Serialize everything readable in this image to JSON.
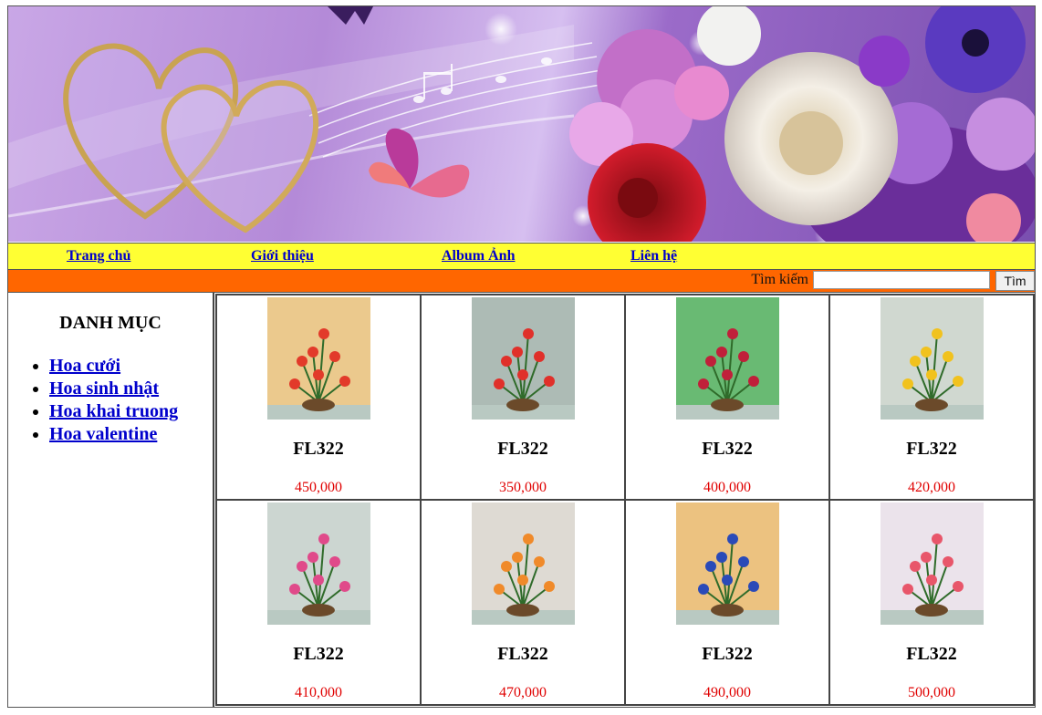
{
  "nav": {
    "items": [
      {
        "label": "Trang chủ"
      },
      {
        "label": "Giới thiệu"
      },
      {
        "label": "Album Ảnh"
      },
      {
        "label": "Liên hệ"
      }
    ]
  },
  "search": {
    "label": "Tìm kiếm",
    "placeholder": "",
    "button_label": "Tìm"
  },
  "sidebar": {
    "title": "DANH MỤC",
    "items": [
      {
        "label": "Hoa cưới"
      },
      {
        "label": "Hoa sinh nhật"
      },
      {
        "label": "Hoa khai truong"
      },
      {
        "label": "Hoa valentine"
      }
    ]
  },
  "products": [
    {
      "code": "FL322",
      "price": "450,000",
      "bg": "#e8c07a",
      "flower": "#e23a2a"
    },
    {
      "code": "FL322",
      "price": "350,000",
      "bg": "#9fb0a9",
      "flower": "#e0302a"
    },
    {
      "code": "FL322",
      "price": "400,000",
      "bg": "#4fae5b",
      "flower": "#c0203a"
    },
    {
      "code": "FL322",
      "price": "420,000",
      "bg": "#c8d2c8",
      "flower": "#f1c21e"
    },
    {
      "code": "FL322",
      "price": "410,000",
      "bg": "#c3cfc9",
      "flower": "#e04a8a"
    },
    {
      "code": "FL322",
      "price": "470,000",
      "bg": "#d9d4cc",
      "flower": "#f08a2a"
    },
    {
      "code": "FL322",
      "price": "490,000",
      "bg": "#e9b86a",
      "flower": "#2a4ab8"
    },
    {
      "code": "FL322",
      "price": "500,000",
      "bg": "#e8dfe8",
      "flower": "#e8566a"
    }
  ],
  "colors": {
    "nav_bg": "#ffff33",
    "search_bar_bg": "#ff6600",
    "link": "#0000cc",
    "price": "#e00000"
  }
}
